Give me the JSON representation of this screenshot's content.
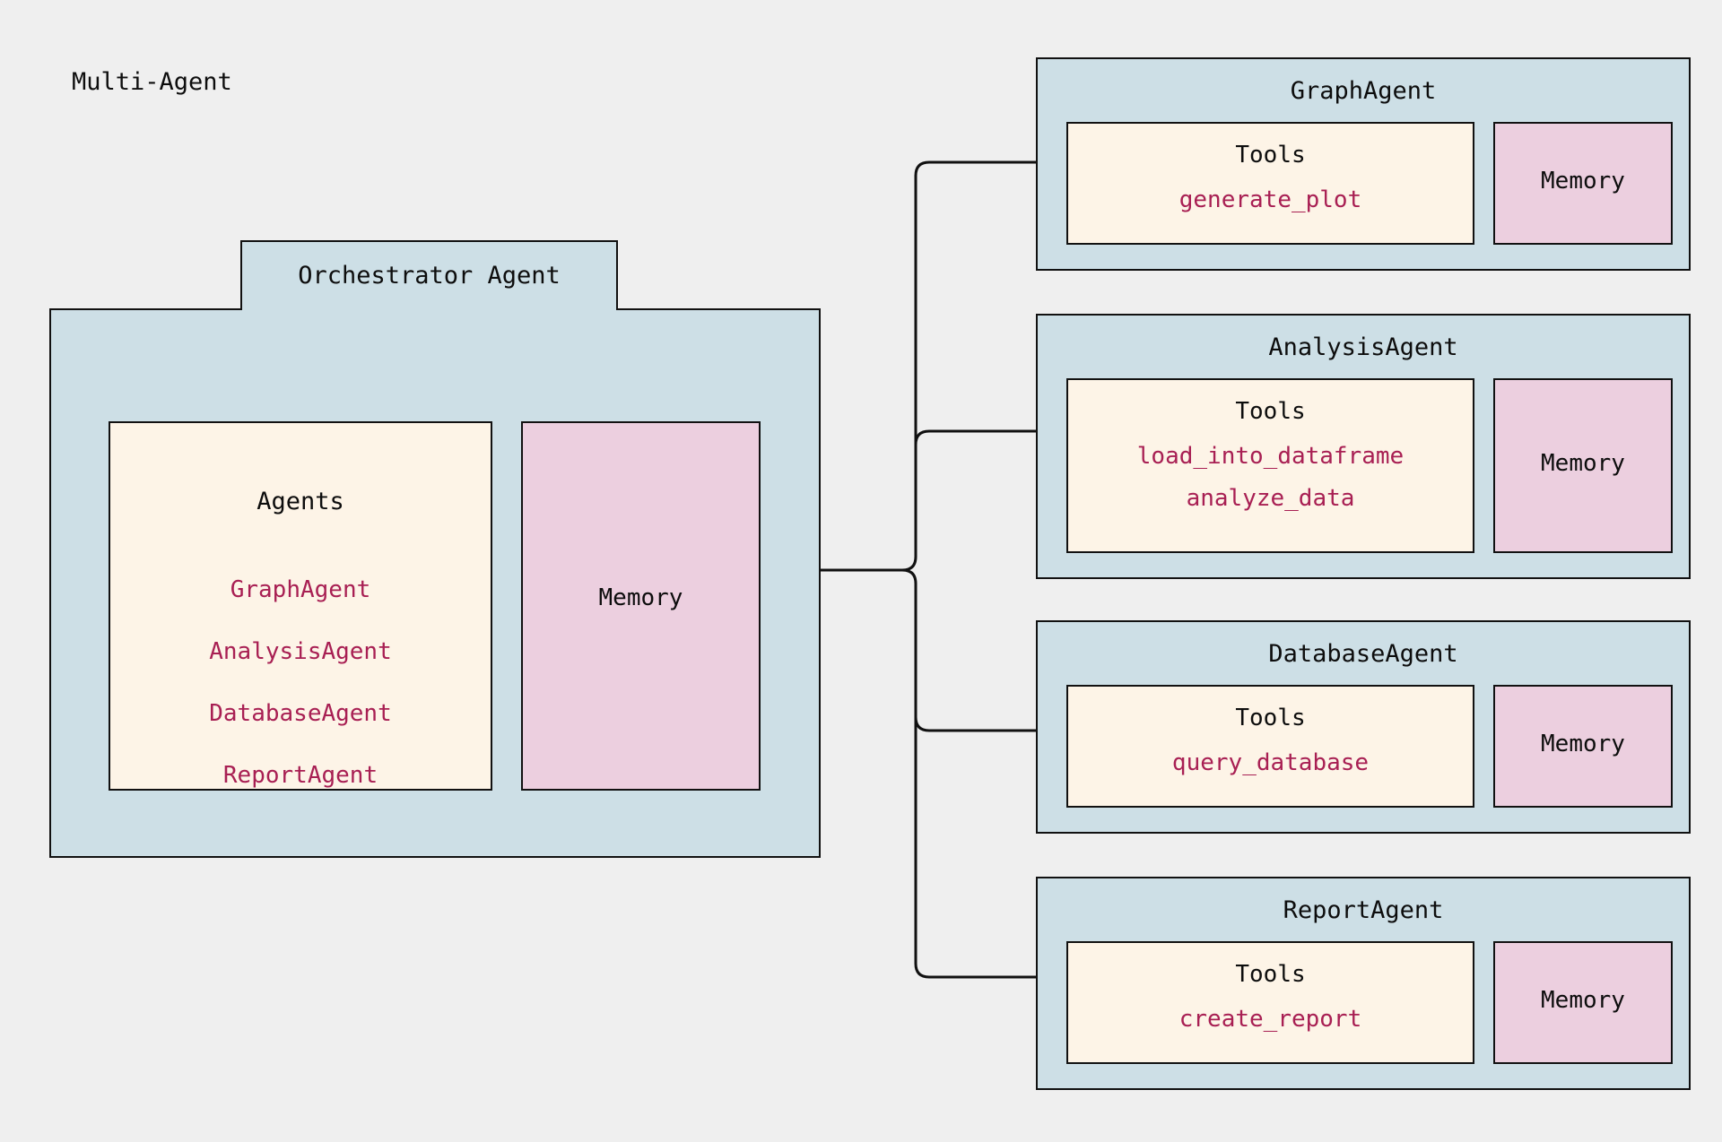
{
  "diagram": {
    "title": "Multi-Agent",
    "colors": {
      "background": "#efefef",
      "agent_fill": "#cddfe6",
      "tools_fill": "#fdf4e7",
      "memory_fill": "#eccfdf",
      "accent_text": "#a81f53",
      "stroke": "#111111"
    }
  },
  "orchestrator": {
    "title": "Orchestrator Agent",
    "agents_panel": {
      "heading": "Agents",
      "items": [
        "GraphAgent",
        "AnalysisAgent",
        "DatabaseAgent",
        "ReportAgent"
      ]
    },
    "memory_panel": {
      "label": "Memory"
    }
  },
  "subagents": [
    {
      "title": "GraphAgent",
      "tools_heading": "Tools",
      "tools": [
        "generate_plot"
      ],
      "memory_label": "Memory"
    },
    {
      "title": "AnalysisAgent",
      "tools_heading": "Tools",
      "tools": [
        "load_into_dataframe",
        "analyze_data"
      ],
      "memory_label": "Memory"
    },
    {
      "title": "DatabaseAgent",
      "tools_heading": "Tools",
      "tools": [
        "query_database"
      ],
      "memory_label": "Memory"
    },
    {
      "title": "ReportAgent",
      "tools_heading": "Tools",
      "tools": [
        "create_report"
      ],
      "memory_label": "Memory"
    }
  ]
}
